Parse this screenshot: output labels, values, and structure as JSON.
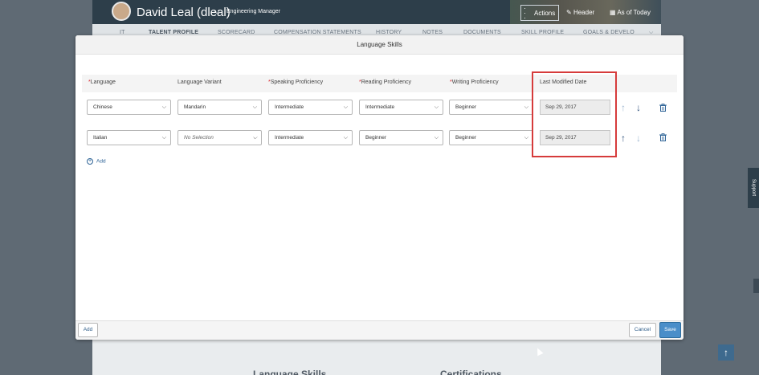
{
  "header": {
    "user_name": "David Leal (dleal)",
    "user_caret": "⌵",
    "user_title": "Engineering Manager",
    "actions_label": "Actions",
    "header_label": "Header",
    "as_of_label": "As of Today"
  },
  "nav": {
    "tabs": [
      "IT",
      "TALENT PROFILE",
      "SCORECARD",
      "COMPENSATION STATEMENTS",
      "HISTORY",
      "NOTES",
      "DOCUMENTS",
      "SKILL PROFILE",
      "GOALS & DEVELO"
    ],
    "overflow_icon": "chevron-down-icon"
  },
  "support_label": "Support",
  "scroll_top_icon": "arrow-up-icon",
  "bottom_headings": [
    "Language Skills",
    "Certifications"
  ],
  "modal": {
    "title": "Language Skills",
    "columns": {
      "language": "Language",
      "variant": "Language Variant",
      "speaking": "Speaking Proficiency",
      "reading": "Reading Proficiency",
      "writing": "Writing Proficiency",
      "modified": "Last Modified Date"
    },
    "rows": [
      {
        "language": "Chinese",
        "variant": "Mandarin",
        "speaking": "Intermediate",
        "reading": "Intermediate",
        "writing": "Beginner",
        "modified": "Sep 29, 2017"
      },
      {
        "language": "Italian",
        "variant": "No Selection",
        "speaking": "Intermediate",
        "reading": "Beginner",
        "writing": "Beginner",
        "modified": "Sep 29, 2017"
      }
    ],
    "add_link": "Add",
    "footer": {
      "add": "Add",
      "cancel": "Cancel",
      "save": "Save"
    }
  },
  "colors": {
    "accent": "#4a8ec9",
    "highlight": "#d63b3b",
    "required": "#d9262c"
  }
}
